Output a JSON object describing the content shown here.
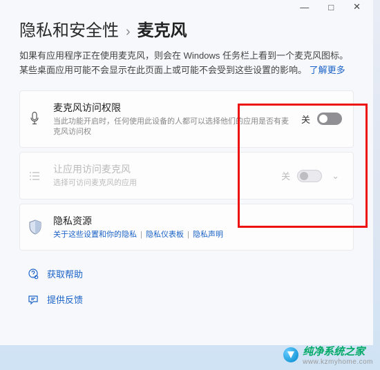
{
  "titlebar": {
    "min": "—",
    "max": "□",
    "close": "✕"
  },
  "header": {
    "section": "隐私和安全性",
    "chevron": "›",
    "page": "麦克风"
  },
  "description": {
    "text": "如果有应用程序正在使用麦克风，则会在 Windows 任务栏上看到一个麦克风图标。 某些桌面应用可能不会显示在此页面上或可能不会受到这些设置的影响。 ",
    "learn_more": "了解更多"
  },
  "settings": {
    "mic_access": {
      "title": "麦克风访问权限",
      "sub": "当此功能开启时，任何使用此设备的人都可以选择他们的应用是否有麦克风访问权",
      "state": "关"
    },
    "app_access": {
      "title": "让应用访问麦克风",
      "sub": "选择可访问麦克风的应用",
      "state": "关"
    },
    "privacy_resources": {
      "title": "隐私资源",
      "links": {
        "about": "关于这些设置和你的隐私",
        "dashboard": "隐私仪表板",
        "statement": "隐私声明"
      },
      "sep": "|"
    }
  },
  "footer": {
    "help": "获取帮助",
    "feedback": "提供反馈"
  },
  "watermark": {
    "name": "纯净系统之家",
    "url": "www.kzmyhome.com"
  }
}
